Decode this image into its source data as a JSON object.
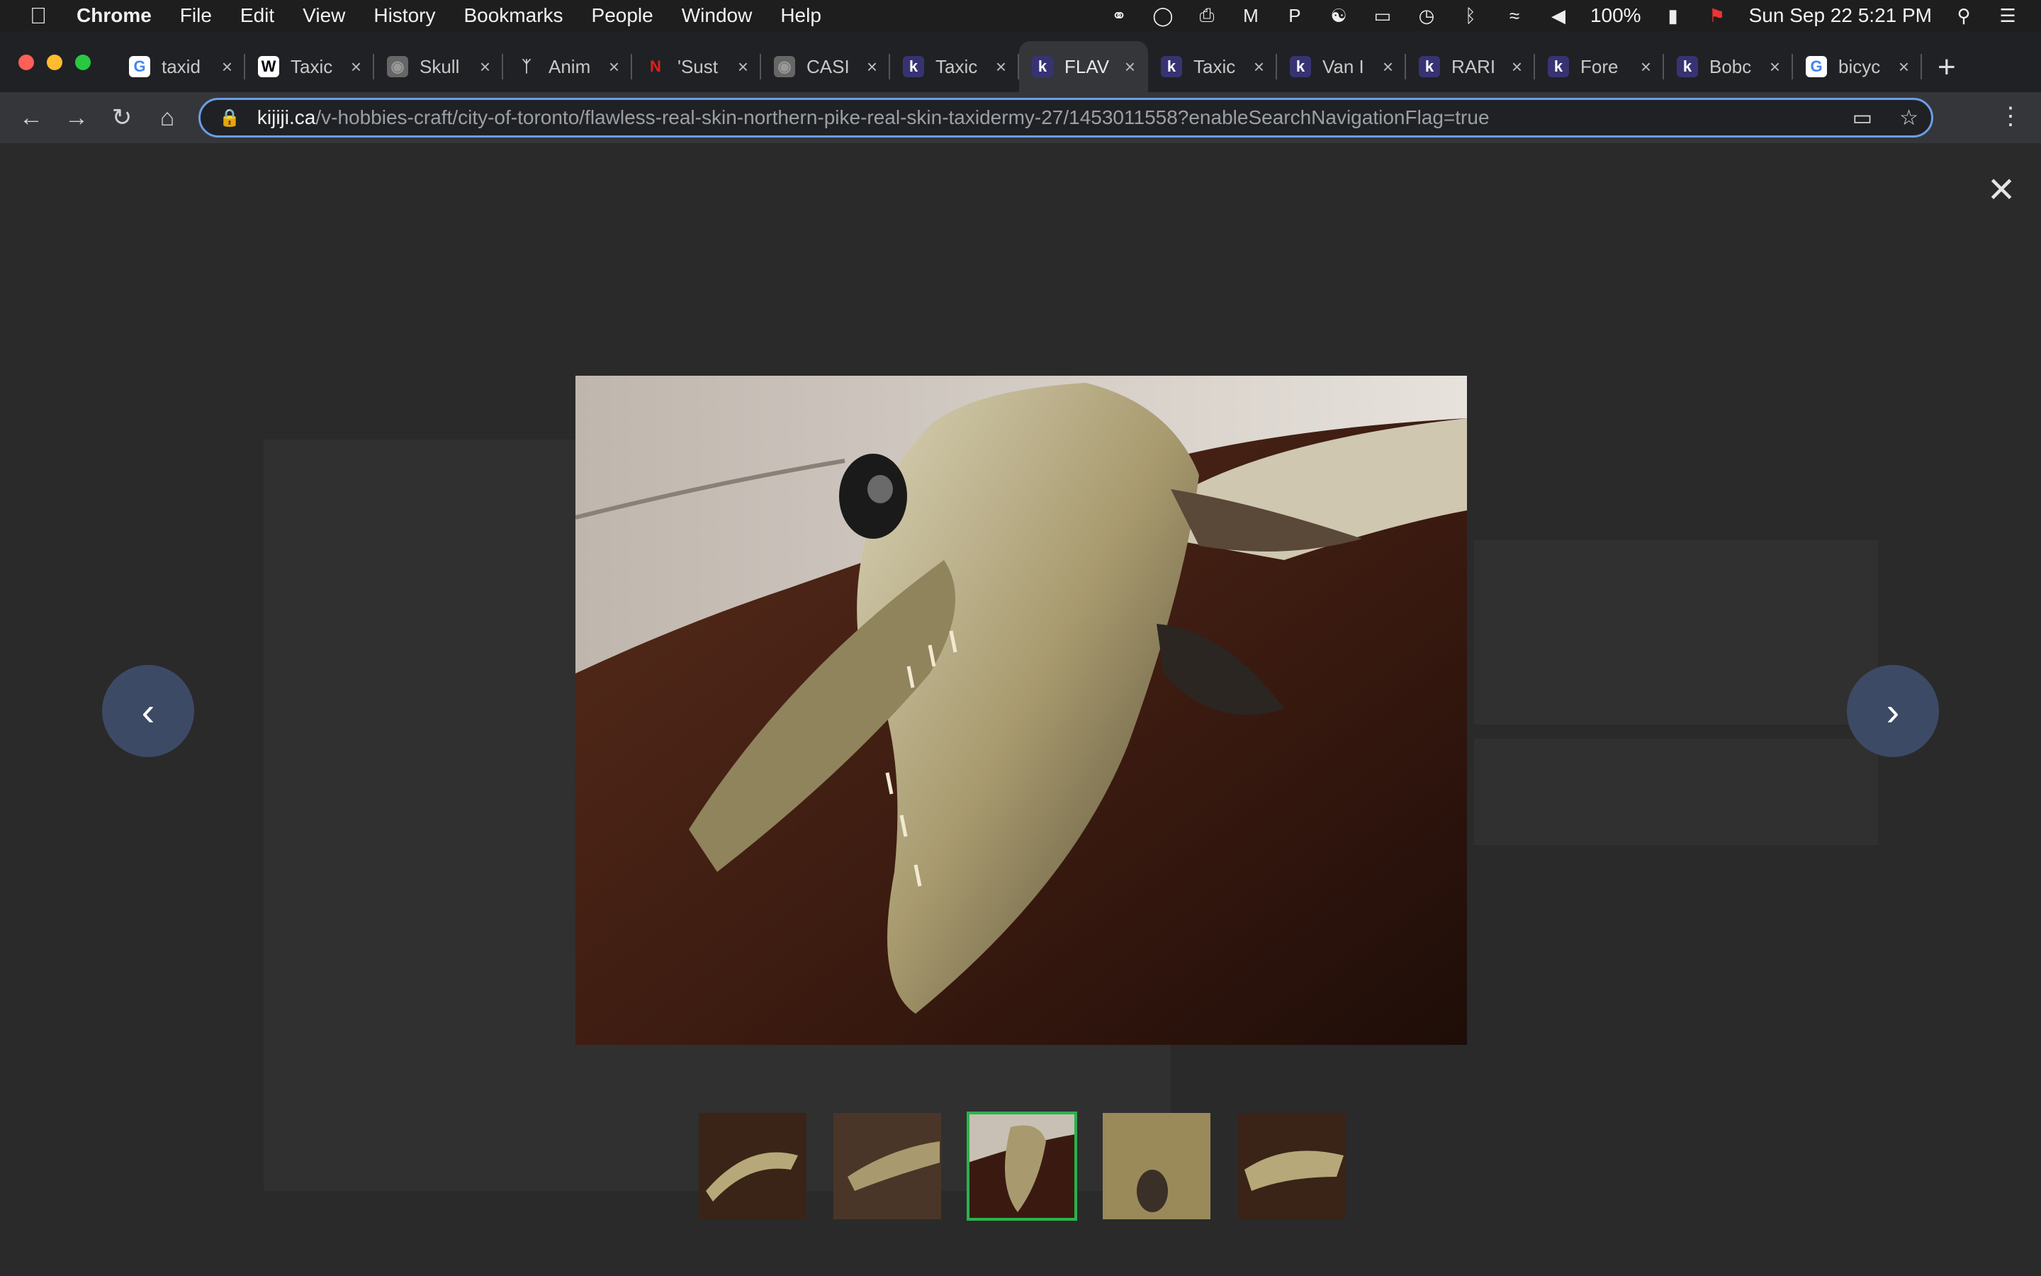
{
  "menubar": {
    "app": "Chrome",
    "items": [
      "File",
      "Edit",
      "View",
      "History",
      "Bookmarks",
      "People",
      "Window",
      "Help"
    ],
    "battery": "100%",
    "datetime": "Sun Sep 22  5:21 PM"
  },
  "tabs": [
    {
      "title": "taxid",
      "favicon": "google-icon"
    },
    {
      "title": "Taxic",
      "favicon": "wikipedia-icon"
    },
    {
      "title": "Skull",
      "favicon": "globe-icon"
    },
    {
      "title": "Anim",
      "favicon": "antler-icon"
    },
    {
      "title": "'Sust",
      "favicon": "now-icon"
    },
    {
      "title": "CASI",
      "favicon": "globe-icon"
    },
    {
      "title": "Taxic",
      "favicon": "kijiji-icon"
    },
    {
      "title": "FLAV",
      "favicon": "kijiji-icon",
      "active": true
    },
    {
      "title": "Taxic",
      "favicon": "kijiji-icon"
    },
    {
      "title": "Van I",
      "favicon": "kijiji-icon"
    },
    {
      "title": "RARI",
      "favicon": "kijiji-icon"
    },
    {
      "title": "Fore",
      "favicon": "kijiji-icon"
    },
    {
      "title": "Bobc",
      "favicon": "kijiji-icon"
    },
    {
      "title": "bicyc",
      "favicon": "google-icon"
    }
  ],
  "omnibox": {
    "domain": "kijiji.ca",
    "path": "/v-hobbies-craft/city-of-toronto/flawless-real-skin-northern-pike-real-skin-taxidermy-27/1453011558?enableSearchNavigationFlag=true"
  },
  "gallery": {
    "thumb_count": 5,
    "selected_index": 2
  },
  "colors": {
    "accent": "#6b9ee6",
    "selected_thumb": "#2bb24c",
    "arrow_bg": "#3d4a66"
  }
}
